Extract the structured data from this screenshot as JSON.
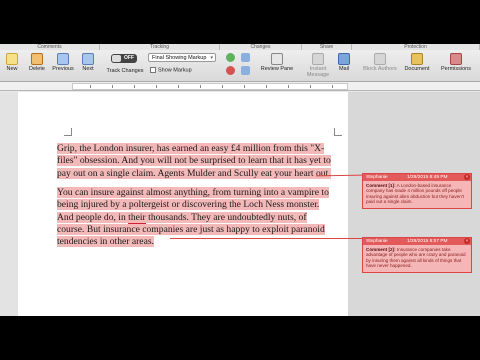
{
  "ribbon": {
    "groups": [
      "Comments",
      "Tracking",
      "Changes",
      "Share",
      "Protection"
    ],
    "buttons": {
      "new": "New",
      "delete": "Delete",
      "previous": "Previous",
      "next": "Next",
      "track_changes": "Track Changes",
      "review_pane": "Review Pane",
      "instant_message": "Instant Message",
      "mail": "Mail",
      "block_authors": "Block Authors",
      "document": "Document",
      "permissions": "Permissions"
    },
    "toggle_state": "OFF",
    "markup_select": "Final Showing Markup",
    "show_markup": "Show Markup"
  },
  "document": {
    "paragraph1_line1": "Grip, the London insurer, has earned an easy £4 million from this \"X-",
    "paragraph1_line2": "files\" obsession. And you will not be surprised to learn that it has yet to",
    "paragraph1_line3": "pay out on a single claim. Agents Mulder and Scully eat your heart out.",
    "paragraph2_a": "You can insure against almost anything, from turning into a vampire to being injured by a poltergeist or discovering the Loch Ness monster. And people do, in ",
    "paragraph2_underlined": "their",
    "paragraph2_b": " thousands. They are undoubtedly nuts, of course. But insurance companies are just as happy to exploit paranoid tendencies in other areas."
  },
  "comments": [
    {
      "author": "Stephanie",
      "time": "1/29/2015 6:49 PM",
      "label": "Comment [1]:",
      "text": "A London-based insurance company has made 4 million pounds off people insuring against alien abduction but they haven't paid out a single claim."
    },
    {
      "author": "Stephanie",
      "time": "1/29/2015 6:57 PM",
      "label": "Comment [2]:",
      "text": "Insurance companies take advantage of people who are crazy and paranoid by insuring them against all kinds of things that have never happened."
    }
  ],
  "colors": {
    "highlight": "#f3b9b9",
    "balloon": "#f4b6b6",
    "balloon_header": "#e25a5a"
  }
}
